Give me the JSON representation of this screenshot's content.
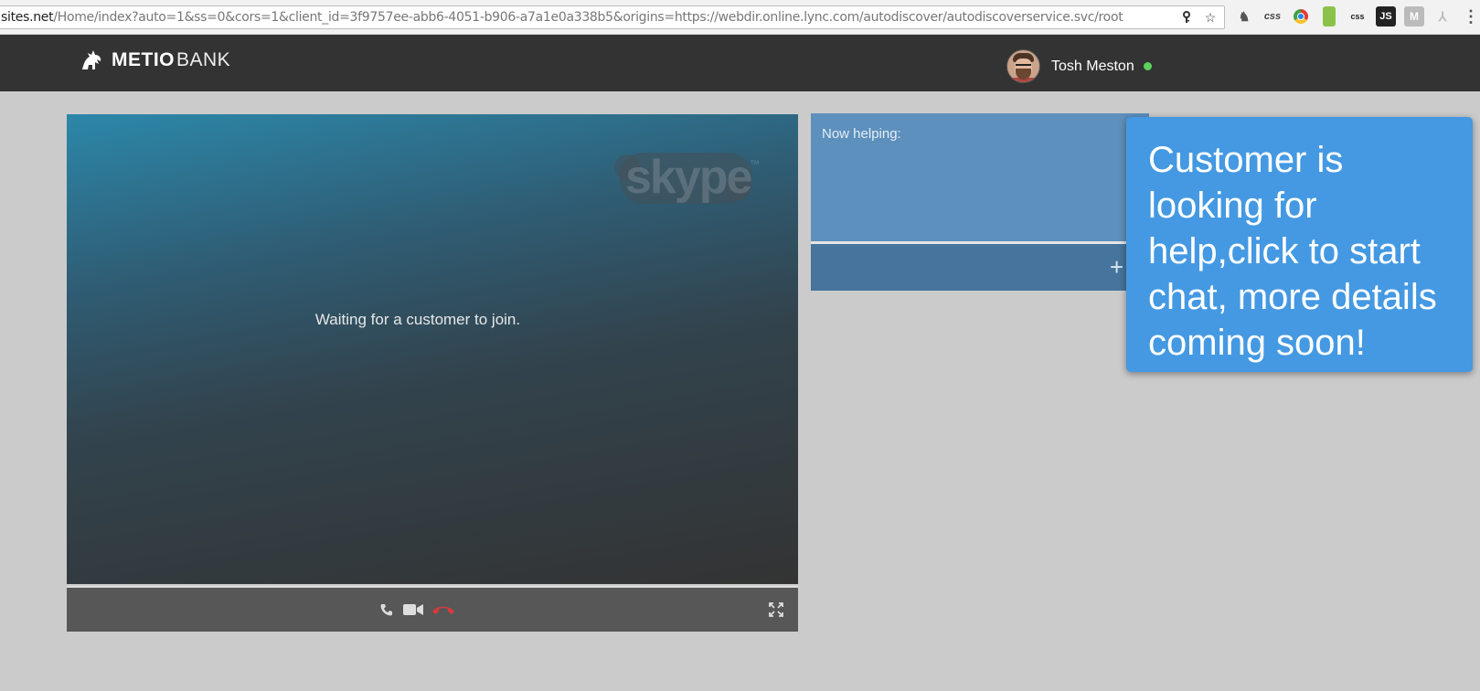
{
  "browser": {
    "url_host": "sites.net",
    "url_path": "/Home/index?auto=1&ss=0&cors=1&client_id=3f9757ee-abb6-4051-b906-a7a1e0a338b5&origins=https://webdir.online.lync.com/autodiscover/autodiscoverservice.svc/root",
    "extensions": [
      {
        "name": "ghostery-icon",
        "text": "♞"
      },
      {
        "name": "css-viewer-icon",
        "text": "css"
      },
      {
        "name": "chrome-ext-icon",
        "text": ""
      },
      {
        "name": "green-ext-icon",
        "text": ""
      },
      {
        "name": "css-ext-icon",
        "text": "css"
      },
      {
        "name": "js-ext-icon",
        "text": "JS"
      },
      {
        "name": "m-ext-icon",
        "text": "M"
      },
      {
        "name": "pdf-ext-icon",
        "text": "⅄"
      },
      {
        "name": "menu-icon",
        "text": "⋮"
      }
    ]
  },
  "header": {
    "logo_bold": "METIO",
    "logo_light": "BANK",
    "user_name": "Tosh Meston",
    "status_color": "#5dd05d"
  },
  "video": {
    "waiting_text": "Waiting for a customer to join.",
    "brand_icon": "skype-logo"
  },
  "side": {
    "now_helping_label": "Now helping:",
    "add_label": "+"
  },
  "toast": {
    "message": "Customer is looking for help,click to start chat, more details coming soon!"
  },
  "colors": {
    "header_bg": "#333333",
    "toast_bg": "#4499e2",
    "helping_bg": "#5d90bc",
    "add_bar_bg": "#46749c"
  }
}
